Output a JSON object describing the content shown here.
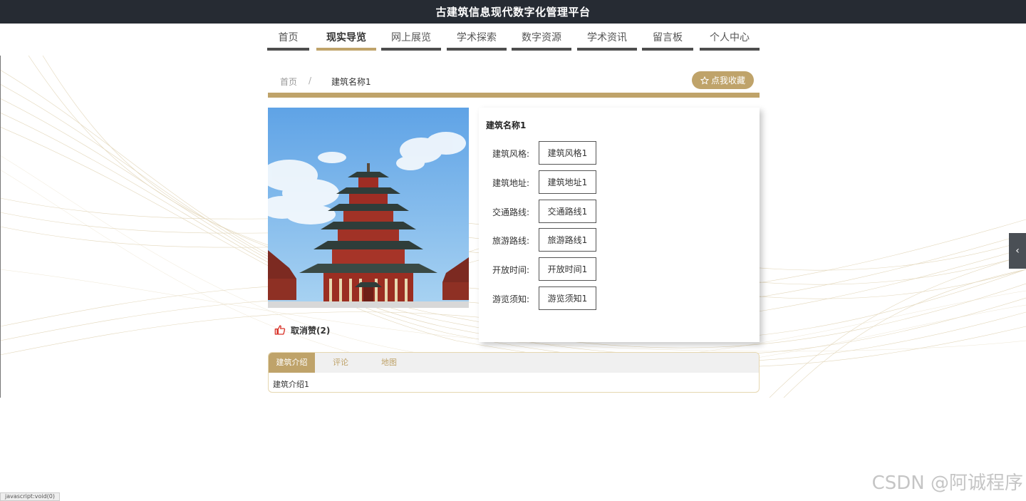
{
  "app_title": "古建筑信息现代数字化管理平台",
  "nav": {
    "items": [
      {
        "label": "首页",
        "active": false
      },
      {
        "label": "现实导览",
        "active": true
      },
      {
        "label": "网上展览",
        "active": false
      },
      {
        "label": "学术探索",
        "active": false
      },
      {
        "label": "数字资源",
        "active": false
      },
      {
        "label": "学术资讯",
        "active": false
      },
      {
        "label": "留言板",
        "active": false
      },
      {
        "label": "个人中心",
        "active": false
      }
    ]
  },
  "breadcrumb": {
    "home": "首页",
    "separator": "/",
    "current": "建筑名称1"
  },
  "favorite_button": {
    "icon": "star-outline-icon",
    "label": "点我收藏"
  },
  "like": {
    "icon": "thumbs-up-icon",
    "label": "取消赞(2)"
  },
  "details": {
    "title": "建筑名称1",
    "fields": [
      {
        "label": "建筑风格:",
        "value": "建筑风格1"
      },
      {
        "label": "建筑地址:",
        "value": "建筑地址1"
      },
      {
        "label": "交通路线:",
        "value": "交通路线1"
      },
      {
        "label": "旅游路线:",
        "value": "旅游路线1"
      },
      {
        "label": "开放时间:",
        "value": "开放时间1"
      },
      {
        "label": "游览须知:",
        "value": "游览须知1"
      }
    ]
  },
  "tabs": {
    "items": [
      {
        "label": "建筑介绍",
        "active": true
      },
      {
        "label": "评论",
        "active": false
      },
      {
        "label": "地图",
        "active": false
      }
    ],
    "content": "建筑介绍1"
  },
  "side_toggle": {
    "icon": "chevron-left-icon"
  },
  "status_bar": "javascript:void(0)",
  "watermark": "CSDN @阿诚程序",
  "colors": {
    "topbar": "#262b33",
    "accent_gold": "#bfa36a",
    "nav_underline": "#4e4e4e"
  }
}
